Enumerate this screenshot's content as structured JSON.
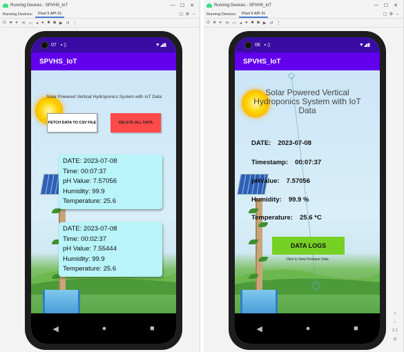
{
  "panels": [
    {
      "window_title": "Running Devices - SPVHS_IoT",
      "tab_label": "Running Devices:",
      "device_tab": "Pixel 5 API 31",
      "status_time": "07",
      "app_title": "SPVHS_IoT",
      "marquee_text": "Solar Powered Vertical Hydroponics System with IoT Data",
      "fetch_button": "FETCH DATA TO CSV FILE",
      "delete_button": "DELETE ALL DATA",
      "cards": [
        {
          "date": "DATE: 2023-07-08",
          "time": "Time: 00:07:37",
          "ph": "pH Value: 7.57056",
          "humidity": "Humidity: 99.9",
          "temperature": "Temperature: 25.6"
        },
        {
          "date": "DATE: 2023-07-08",
          "time": "Time: 00:02:37",
          "ph": "pH Value: 7.55444",
          "humidity": "Humidity: 99.9",
          "temperature": "Temperature: 25.6"
        }
      ]
    },
    {
      "window_title": "Running Devices - SPVHS_IoT",
      "tab_label": "Running Devices:",
      "device_tab": "Pixel 5 API 31",
      "status_time": "06",
      "app_title": "SPVHS_IoT",
      "heading": "Solar Powered Vertical Hydroponics System with IoT Data",
      "rows": [
        {
          "label": "DATE:",
          "value": "2023-07-08"
        },
        {
          "label": "Timestamp:",
          "value": "00:07:37"
        },
        {
          "label": "pHValue:",
          "value": "7.57056"
        },
        {
          "label": "Humidity:",
          "value": "99.9 %"
        },
        {
          "label": "Temperature:",
          "value": "25.6 *C"
        }
      ],
      "logs_button": "DATA LOGS",
      "logs_caption": "Click to View Firebase Data"
    }
  ],
  "icons": {
    "minimize": "—",
    "maximize": "☐",
    "close": "✕",
    "back": "◀",
    "home": "●",
    "recents": "■"
  },
  "colors": {
    "statusbar": "#3a0ca3",
    "appbar": "#6200ee",
    "delete_button": "#ff4a4a",
    "logs_button": "#76d124",
    "card": "#b8f4fa"
  }
}
